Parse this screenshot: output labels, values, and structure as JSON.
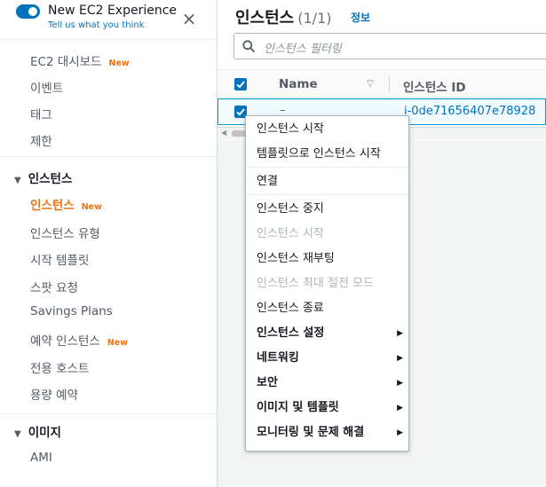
{
  "sidebar": {
    "experience_title": "New EC2 Experience",
    "experience_subtitle": "Tell us what you think",
    "close_glyph": "×",
    "new_badge": "New",
    "top_items": [
      {
        "label": "EC2 대시보드",
        "new": true
      },
      {
        "label": "이벤트"
      },
      {
        "label": "태그"
      },
      {
        "label": "제한"
      }
    ],
    "sections": [
      {
        "title": "인스턴스",
        "items": [
          {
            "label": "인스턴스",
            "new": true,
            "active": true
          },
          {
            "label": "인스턴스 유형"
          },
          {
            "label": "시작 템플릿"
          },
          {
            "label": "스팟 요청"
          },
          {
            "label": "Savings Plans"
          },
          {
            "label": "예약 인스턴스",
            "new": true
          },
          {
            "label": "전용 호스트"
          },
          {
            "label": "용량 예약"
          }
        ]
      },
      {
        "title": "이미지",
        "items": [
          {
            "label": "AMI"
          }
        ]
      }
    ]
  },
  "header": {
    "title": "인스턴스",
    "count": "(1/1)",
    "info_link": "정보",
    "search_placeholder": "인스턴스 필터링"
  },
  "table": {
    "columns": [
      "Name",
      "인스턴스 ID"
    ],
    "rows": [
      {
        "name": "–",
        "instance_id": "i-0de71656407e78928",
        "selected": true
      }
    ]
  },
  "context_menu": {
    "items": [
      {
        "label": "인스턴스 시작"
      },
      {
        "label": "템플릿으로 인스턴스 시작"
      },
      {
        "separator": true
      },
      {
        "label": "연결"
      },
      {
        "separator": true
      },
      {
        "label": "인스턴스 중지"
      },
      {
        "label": "인스턴스 시작",
        "disabled": true
      },
      {
        "label": "인스턴스 재부팅"
      },
      {
        "label": "인스턴스 최대 절전 모드",
        "disabled": true
      },
      {
        "label": "인스턴스 종료"
      },
      {
        "label": "인스턴스 설정",
        "submenu": true
      },
      {
        "label": "네트워킹",
        "submenu": true
      },
      {
        "label": "보안",
        "submenu": true
      },
      {
        "label": "이미지 및 템플릿",
        "submenu": true
      },
      {
        "label": "모니터링 및 문제 해결",
        "submenu": true
      }
    ]
  },
  "colors": {
    "accent": "#0073bb",
    "active_nav": "#ec7211",
    "selected_row_bg": "#f1faff",
    "selected_row_border": "#00a1c9"
  },
  "icons": {
    "toggle": "toggle-on-icon",
    "close": "close-icon",
    "search": "search-icon",
    "caret": "caret-down-icon",
    "sort": "sort-icon",
    "submenu": "chevron-right-icon"
  }
}
